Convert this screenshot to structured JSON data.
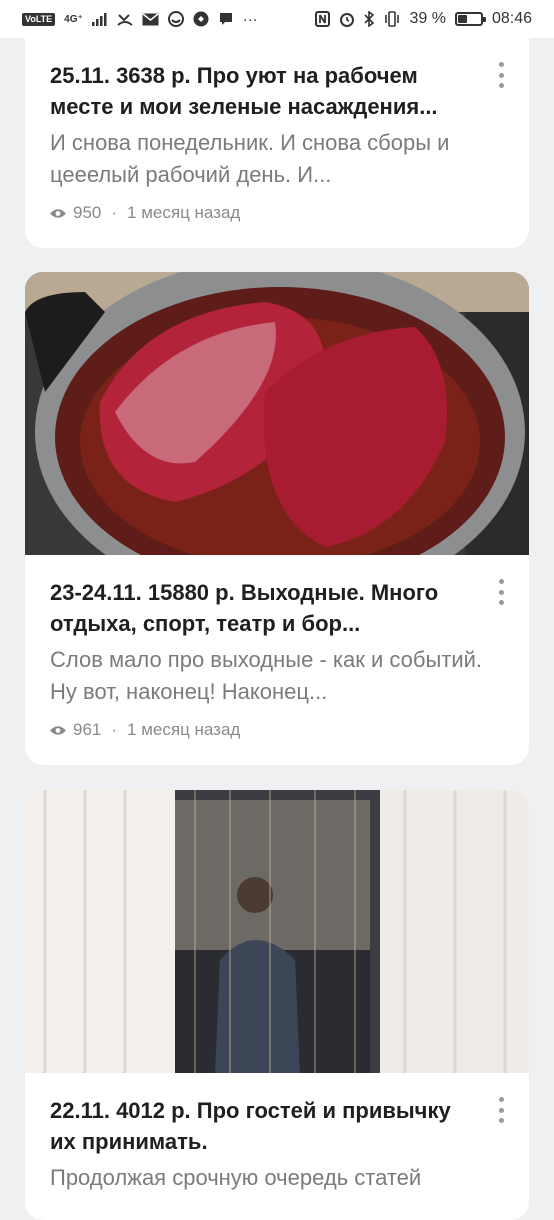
{
  "statusbar": {
    "volte": "VoLTE",
    "network": "4G⁺",
    "battery_text": "39 %",
    "battery_level": 0.39,
    "time": "08:46"
  },
  "feed": [
    {
      "title": "25.11. 3638 р. Про уют на рабочем месте и мои зеленые насаждения...",
      "snippet": "И снова понедельник. И снова сборы и цееелый рабочий день. И...",
      "views": "950",
      "age": "1 месяц назад"
    },
    {
      "title": "23-24.11. 15880 р. Выходные. Много отдыха, спорт, театр и бор...",
      "snippet": "Слов мало про выходные - как и событий. Ну вот, наконец! Наконец...",
      "views": "961",
      "age": "1 месяц назад"
    },
    {
      "title": "22.11. 4012 р. Про гостей и привычку их принимать.",
      "snippet": "Продолжая срочную очередь статей"
    }
  ],
  "icons": {
    "views": "eye-icon",
    "more": "more-vertical-icon"
  }
}
